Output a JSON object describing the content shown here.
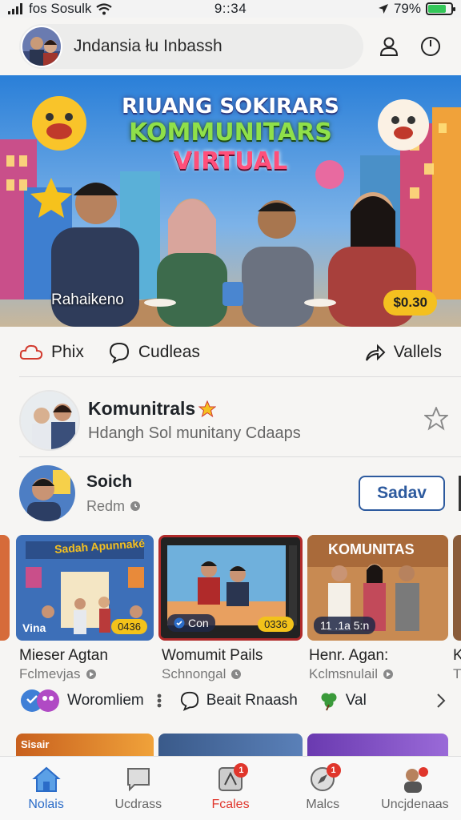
{
  "status_bar": {
    "carrier": "fos Sosulk",
    "time": "9::34",
    "battery": "79%"
  },
  "header": {
    "title": "Jndansia łu Inbassh"
  },
  "hero": {
    "title_line1": "RIUANG SOKIRARS",
    "title_line2": "KOMMUNITARS",
    "title_line3": "VIRTUAL",
    "caption": "Rahaikeno",
    "price": "$0.30"
  },
  "actions": {
    "item1": "Phix",
    "item2": "Cudleas",
    "item3": "Vallels"
  },
  "community": {
    "title": "Komunitrals",
    "subtitle": "Hdangh Sol munitany Cdaaps"
  },
  "user": {
    "name": "Soich",
    "sub": "Redm",
    "button": "Sadav"
  },
  "cards": [
    {
      "title": "Mieser Agtan",
      "sub": "Fclmevjas",
      "img_text": "Sadah Apunnaké",
      "chip": "0436",
      "tag": "Vina"
    },
    {
      "title": "Womumit Pails",
      "sub": "Schnongal",
      "chip": "0336",
      "tag": "Con"
    },
    {
      "title": "Henr. Agan:",
      "sub": "Kclmsnulail",
      "img_text": "KOMUNITAS",
      "tag": "11 .1a 5:n"
    },
    {
      "title": "K",
      "sub": "T"
    }
  ],
  "bottom_row": {
    "item1": "Woromliem",
    "item2": "Beait Rnaash",
    "item3": "Val"
  },
  "peeks": {
    "first": "Sisair"
  },
  "tabs": [
    {
      "label": "Nolais",
      "badge": ""
    },
    {
      "label": "Ucdrass",
      "badge": ""
    },
    {
      "label": "Fcales",
      "badge": "1"
    },
    {
      "label": "Malcs",
      "badge": "1"
    },
    {
      "label": "Uncjdenaas",
      "badge": ""
    }
  ],
  "colors": {
    "accent": "#2b6cc8",
    "hot": "#e0362c",
    "price": "#f4c020",
    "save": "#2d5a9e"
  }
}
